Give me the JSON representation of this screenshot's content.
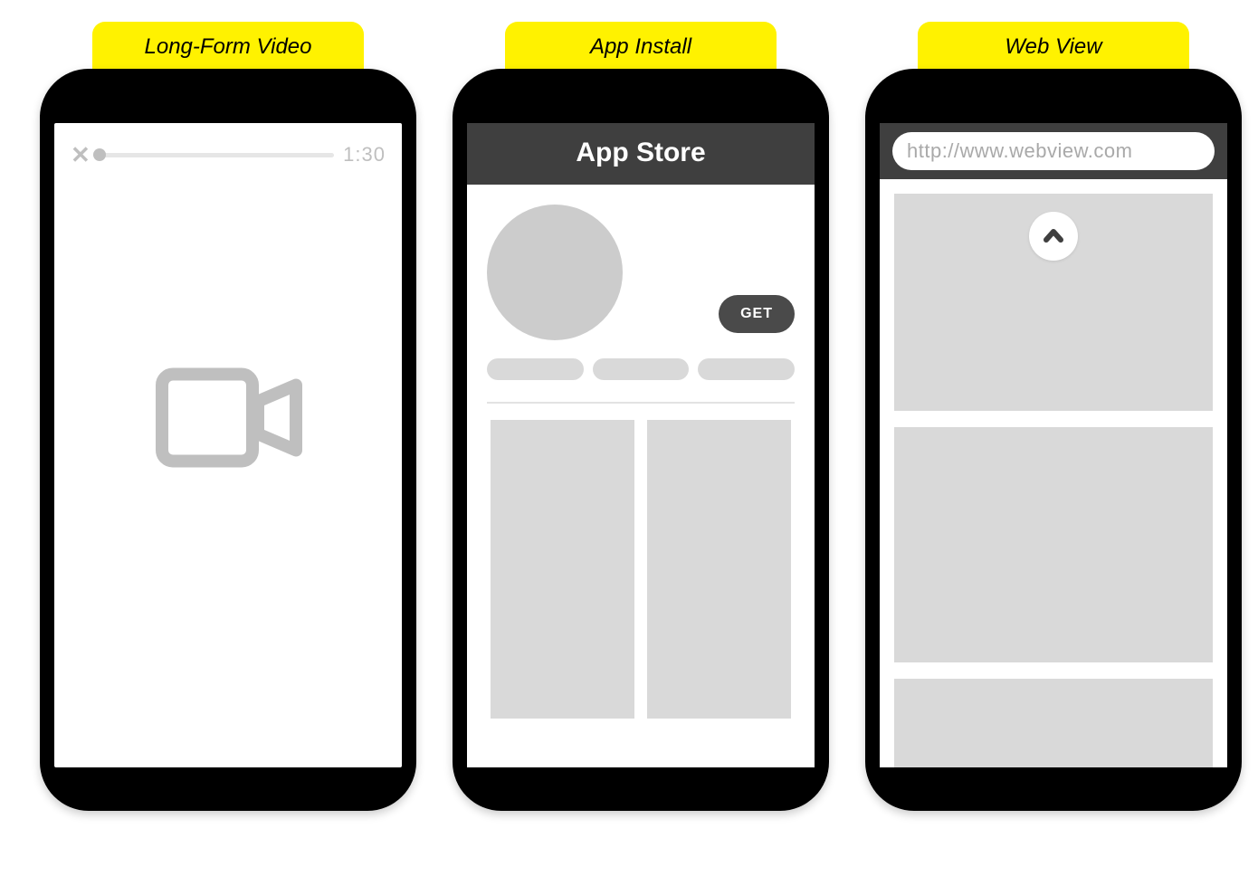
{
  "columns": {
    "video": {
      "label": "Long-Form Video",
      "time": "1:30"
    },
    "app": {
      "label": "App Install",
      "header": "App Store",
      "get_label": "GET"
    },
    "web": {
      "label": "Web View",
      "url": "http://www.webview.com"
    }
  },
  "colors": {
    "accent": "#fff200",
    "phone": "#000000",
    "placeholder": "#d9d9d9",
    "darkbar": "#3f3f3f",
    "muted": "#bfbfbf"
  }
}
